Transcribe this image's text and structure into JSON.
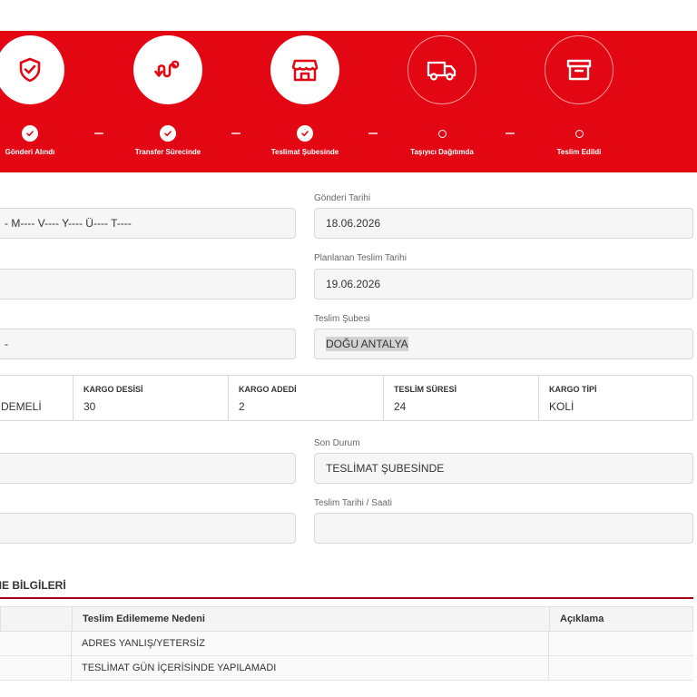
{
  "progress": {
    "steps": [
      {
        "label": "Gönderi Alındı",
        "icon": "shield-check-icon",
        "status": "done"
      },
      {
        "label": "Transfer Sürecinde",
        "icon": "route-icon",
        "status": "done"
      },
      {
        "label": "Teslimat Şubesinde",
        "icon": "store-icon",
        "status": "done"
      },
      {
        "label": "Taşıyıcı Dağıtımda",
        "icon": "truck-icon",
        "status": "pending"
      },
      {
        "label": "Teslim Edildi",
        "icon": "archive-box-icon",
        "status": "pending"
      }
    ],
    "colors": {
      "band": "#e30613",
      "icon": "#e30613"
    }
  },
  "form": {
    "recipient_value": "- M---- V---- Y---- Ü---- T----",
    "shipment_date_label": "Gönderi Tarihi",
    "shipment_date_value": "18.06.2026",
    "planned_delivery_label": "Planlanan Teslim Tarihi",
    "planned_delivery_value": "19.06.2026",
    "left_field_3_value": "-",
    "delivery_branch_label": "Teslim Şubesi",
    "delivery_branch_value": "DOĞU ANTALYA",
    "last_status_label": "Son Durum",
    "last_status_value": "TESLİMAT ŞUBESİNDE",
    "delivery_datetime_label": "Teslim Tarihi / Saati",
    "delivery_datetime_value": ""
  },
  "info": {
    "payment_value": "DEMELİ",
    "desi_label": "KARGO DESİSİ",
    "desi_value": "30",
    "count_label": "KARGO ADEDİ",
    "count_value": "2",
    "duration_label": "TESLİM SÜRESİ",
    "duration_value": "24",
    "type_label": "KARGO TİPİ",
    "type_value": "KOLİ"
  },
  "undelivered": {
    "title": "ME BİLGİLERİ",
    "columns": [
      "",
      "Teslim Edilememe Nedeni",
      "Açıklama"
    ],
    "rows": [
      [
        "",
        "ADRES YANLIŞ/YETERSİZ",
        ""
      ],
      [
        "",
        "TESLİMAT GÜN İÇERİSİNDE YAPILAMADI",
        ""
      ]
    ]
  }
}
